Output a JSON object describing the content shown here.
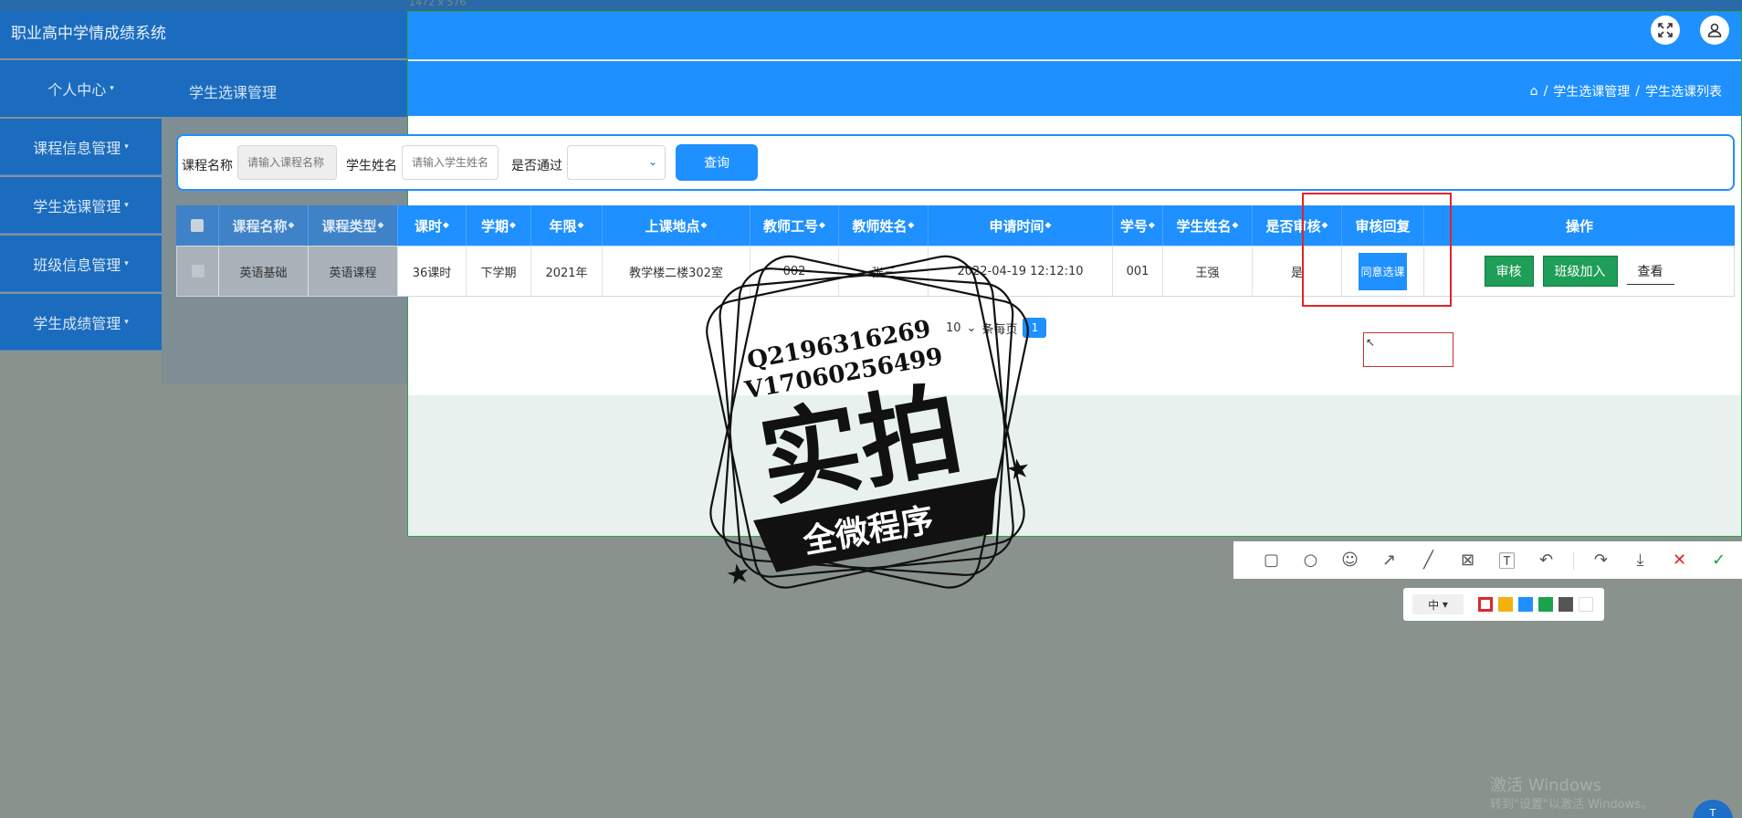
{
  "app": {
    "title": "职业高中学情成绩系统",
    "capture_size": "1472 x 576"
  },
  "sidebar": {
    "items": [
      {
        "label": "个人中心"
      },
      {
        "label": "课程信息管理"
      },
      {
        "label": "学生选课管理"
      },
      {
        "label": "班级信息管理"
      },
      {
        "label": "学生成绩管理"
      }
    ]
  },
  "page": {
    "title": "学生选课管理",
    "breadcrumb": [
      "学生选课管理",
      "学生选课列表"
    ],
    "breadcrumb_sep": "/"
  },
  "search": {
    "course_label": "课程名称",
    "course_placeholder": "请输入课程名称",
    "student_label": "学生姓名",
    "student_placeholder": "请输入学生姓名",
    "pass_label": "是否通过",
    "query_label": "查询"
  },
  "table": {
    "columns": [
      "课程名称",
      "课程类型",
      "课时",
      "学期",
      "年限",
      "上课地点",
      "教师工号",
      "教师姓名",
      "申请时间",
      "学号",
      "学生姓名",
      "是否审核",
      "审核回复",
      "操作"
    ],
    "rows": [
      {
        "course_name": "英语基础",
        "course_type": "英语课程",
        "hours": "36课时",
        "term": "下学期",
        "year": "2021年",
        "location": "教学楼二楼302室",
        "teacher_id": "002",
        "teacher_name": "张三",
        "apply_time": "2022-04-19 12:12:10",
        "student_id": "001",
        "student_name": "王强",
        "reviewed": "是",
        "reply": "同意选课"
      }
    ],
    "actions": {
      "review": "审核",
      "join_class": "班级加入",
      "view": "查看"
    }
  },
  "pager": {
    "per_page_value": "10",
    "per_page_suffix": "条每页",
    "current_page": "1"
  },
  "stamp": {
    "line1": "Q2196316269",
    "line2": "V17060256499",
    "main": "实拍",
    "banner": "全微程序"
  },
  "annotation_toolbar": {
    "tools": [
      "rectangle-tool",
      "ellipse-tool",
      "emoji-tool",
      "arrow-tool",
      "line-tool",
      "mosaic-tool",
      "text-tool",
      "undo-tool",
      "redo-tool",
      "save-tool",
      "cancel-tool",
      "confirm-tool"
    ],
    "size_label": "中",
    "colors": [
      "#e0242b",
      "#f2b10f",
      "#1e90ff",
      "#1aa34a",
      "#555555",
      "#ffffff"
    ]
  },
  "os": {
    "activation_line1": "激活 Windows",
    "activation_line2": "转到\"设置\"以激活 Windows。"
  }
}
